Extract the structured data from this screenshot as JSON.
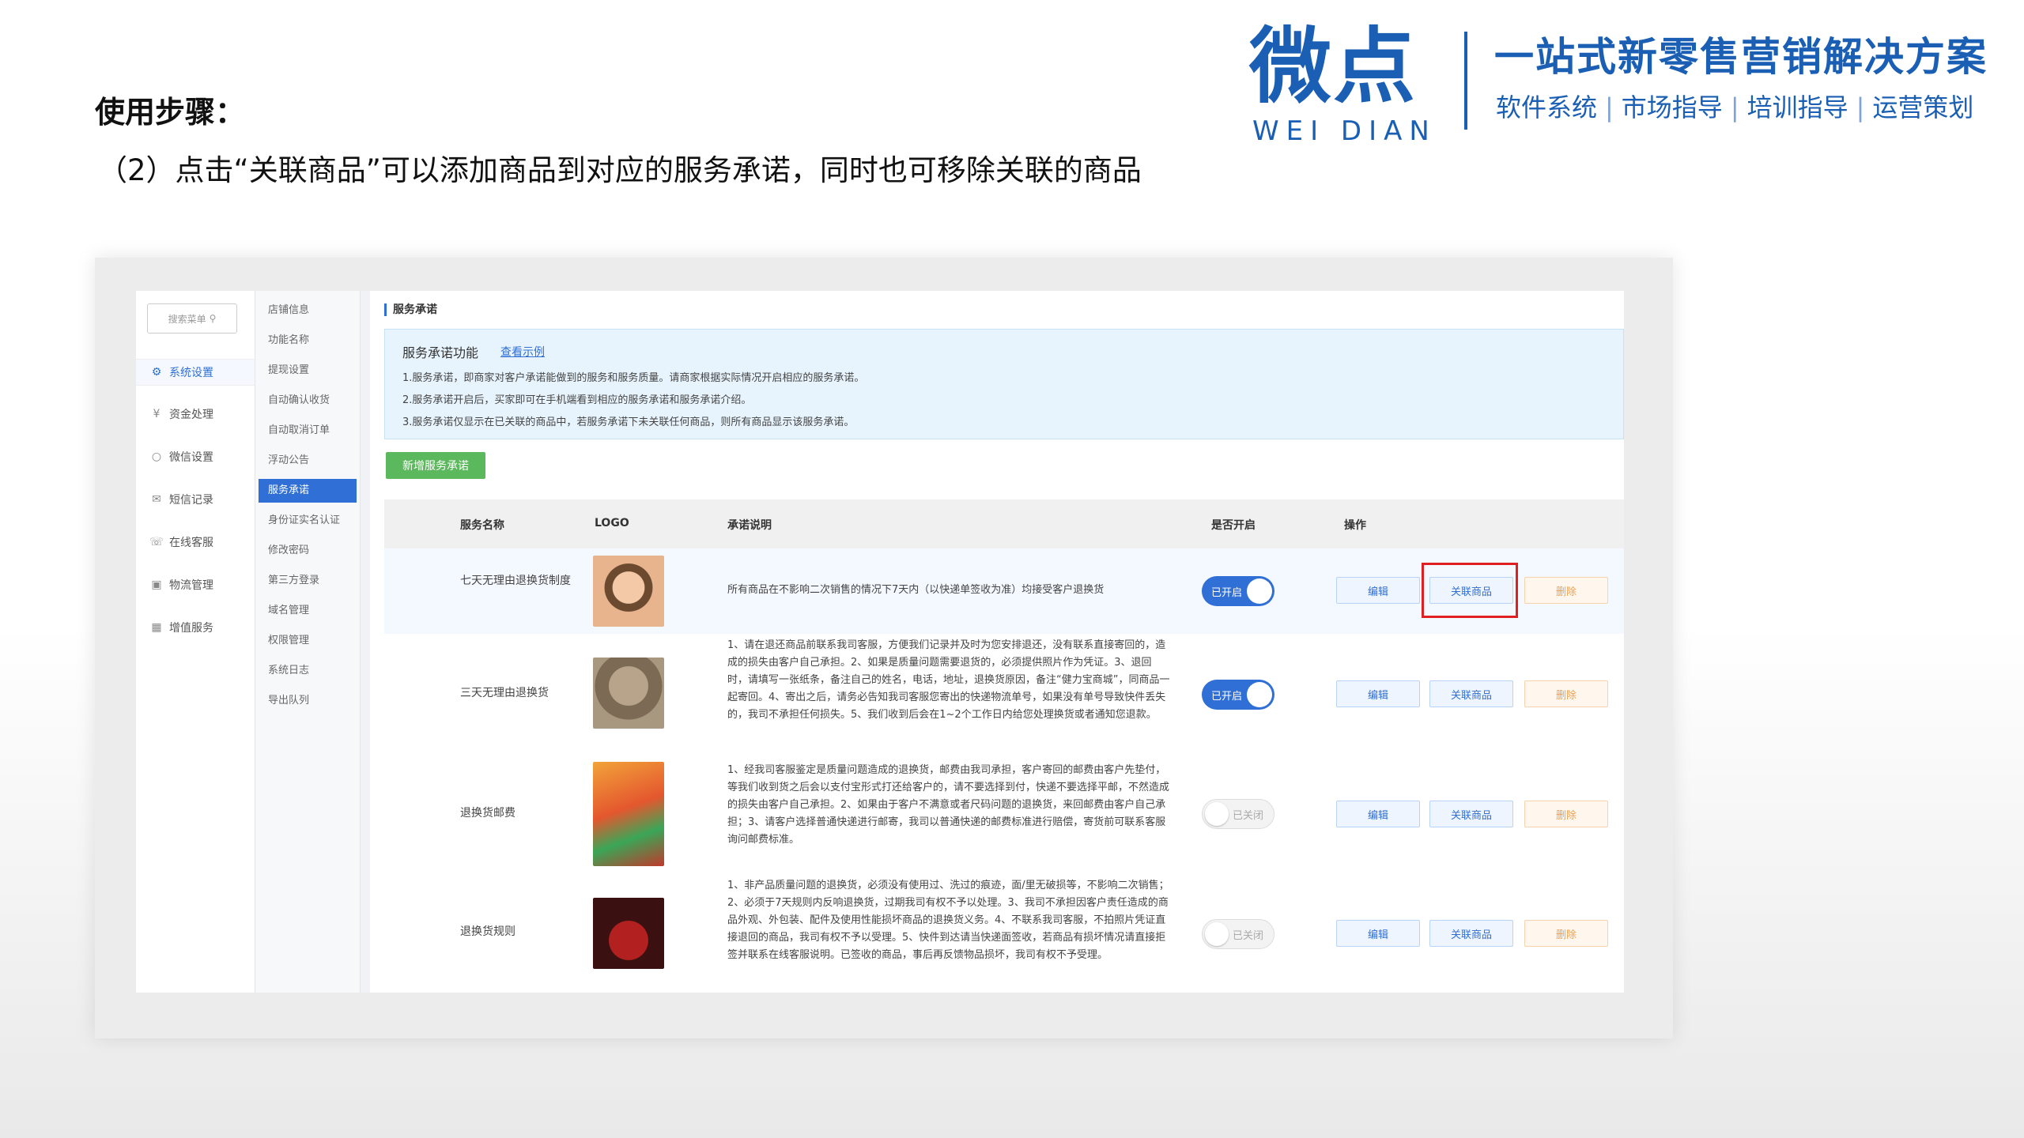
{
  "brand": {
    "logo_cn": "微点",
    "logo_en": "WEI DIAN",
    "slogan": "一站式新零售营销解决方案",
    "services": [
      "软件系统",
      "市场指导",
      "培训指导",
      "运营策划"
    ],
    "color": "#1a5fb4"
  },
  "step": {
    "title": "使用步骤：",
    "desc": "（2）点击“关联商品”可以添加商品到对应的服务承诺，同时也可移除关联的商品"
  },
  "app": {
    "search_placeholder": "搜索菜单",
    "nav1": [
      {
        "label": "系统设置",
        "icon": "gear-icon",
        "active": true
      },
      {
        "label": "资金处理",
        "icon": "money-icon",
        "active": false
      },
      {
        "label": "微信设置",
        "icon": "wechat-icon",
        "active": false
      },
      {
        "label": "短信记录",
        "icon": "message-icon",
        "active": false
      },
      {
        "label": "在线客服",
        "icon": "service-icon",
        "active": false
      },
      {
        "label": "物流管理",
        "icon": "truck-icon",
        "active": false
      },
      {
        "label": "增值服务",
        "icon": "chart-icon",
        "active": false
      }
    ],
    "nav2": [
      {
        "label": "店铺信息",
        "active": false
      },
      {
        "label": "功能名称",
        "active": false
      },
      {
        "label": "提现设置",
        "active": false
      },
      {
        "label": "自动确认收货",
        "active": false
      },
      {
        "label": "自动取消订单",
        "active": false
      },
      {
        "label": "浮动公告",
        "active": false
      },
      {
        "label": "服务承诺",
        "active": true
      },
      {
        "label": "身份证实名认证",
        "active": false
      },
      {
        "label": "修改密码",
        "active": false
      },
      {
        "label": "第三方登录",
        "active": false
      },
      {
        "label": "域名管理",
        "active": false
      },
      {
        "label": "权限管理",
        "active": false
      },
      {
        "label": "系统日志",
        "active": false
      },
      {
        "label": "导出队列",
        "active": false
      }
    ],
    "breadcrumb": "服务承诺",
    "info": {
      "title": "服务承诺功能",
      "link": "查看示例",
      "lines": [
        "1.服务承诺，即商家对客户承诺能做到的服务和服务质量。请商家根据实际情况开启相应的服务承诺。",
        "2.服务承诺开启后，买家即可在手机端看到相应的服务承诺和服务承诺介绍。",
        "3.服务承诺仅显示在已关联的商品中，若服务承诺下未关联任何商品，则所有商品显示该服务承诺。"
      ]
    },
    "add_button": "新增服务承诺",
    "table": {
      "headers": {
        "name": "服务名称",
        "logo": "LOGO",
        "desc": "承诺说明",
        "enabled": "是否开启",
        "ops": "操作"
      },
      "on_label": "已开启",
      "off_label": "已关闭",
      "edit_label": "编辑",
      "link_label": "关联商品",
      "delete_label": "删除",
      "rows": [
        {
          "name": "七天无理由退换货制度",
          "enabled": true,
          "highlighted": true,
          "desc": "所有商品在不影响二次销售的情况下7天内（以快递单签收为准）均接受客户退换货"
        },
        {
          "name": "三天无理由退换货",
          "enabled": true,
          "highlighted": false,
          "desc": "1、请在退还商品前联系我司客服，方便我们记录并及时为您安排退还，没有联系直接寄回的，造成的损失由客户自己承担。2、如果是质量问题需要退货的，必须提供照片作为凭证。3、退回时，请填写一张纸条，备注自己的姓名，电话，地址，退换货原因，备注“健力宝商城”，同商品一起寄回。4、寄出之后，请务必告知我司客服您寄出的快递物流单号，如果没有单号导致快件丢失的，我司不承担任何损失。5、我们收到后会在1~2个工作日内给您处理换货或者通知您退款。"
        },
        {
          "name": "退换货邮费",
          "enabled": false,
          "highlighted": false,
          "desc": "1、经我司客服鉴定是质量问题造成的退换货，邮费由我司承担，客户寄回的邮费由客户先垫付，等我们收到货之后会以支付宝形式打还给客户的，请不要选择到付，快递不要选择平邮，不然造成的损失由客户自己承担。2、如果由于客户不满意或者尺码问题的退换货，来回邮费由客户自己承担；3、请客户选择普通快递进行邮寄，我司以普通快递的邮费标准进行赔偿，寄货前可联系客服询问邮费标准。"
        },
        {
          "name": "退换货规则",
          "enabled": false,
          "highlighted": false,
          "desc": "1、非产品质量问题的退换货，必须没有使用过、洗过的痕迹，面/里无破损等，不影响二次销售；2、必须于7天规则内反响退换货，过期我司有权不予以处理。3、我司不承担因客户责任造成的商品外观、外包装、配件及使用性能损坏商品的退换货义务。4、不联系我司客服，不拍照片凭证直接退回的商品，我司有权不予以受理。5、快件到达请当快递面签收，若商品有损坏情况请直接拒签并联系在线客服说明。已签收的商品，事后再反馈物品损坏，我司有权不予受理。"
        }
      ]
    }
  }
}
